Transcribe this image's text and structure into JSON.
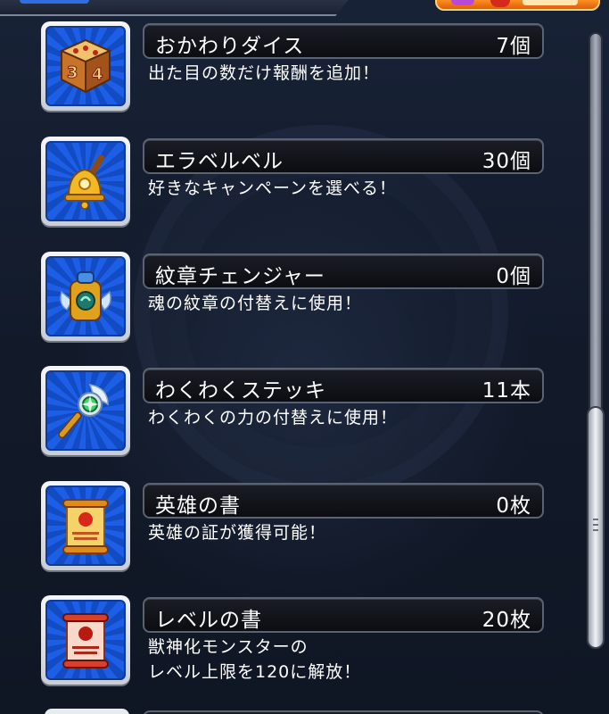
{
  "items": [
    {
      "name": "おかわりダイス",
      "count": "7個",
      "desc1": "出た目の数だけ報酬を追加！",
      "desc2": "",
      "icon": "dice-icon"
    },
    {
      "name": "エラベルベル",
      "count": "30個",
      "desc1": "好きなキャンペーンを選べる！",
      "desc2": "",
      "icon": "bell-icon"
    },
    {
      "name": "紋章チェンジャー",
      "count": "0個",
      "desc1": "魂の紋章の付替えに使用！",
      "desc2": "",
      "icon": "crest-changer-icon"
    },
    {
      "name": "わくわくステッキ",
      "count": "11本",
      "desc1": "わくわくの力の付替えに使用！",
      "desc2": "",
      "icon": "wand-icon"
    },
    {
      "name": "英雄の書",
      "count": "0枚",
      "desc1": "英雄の証が獲得可能！",
      "desc2": "",
      "icon": "scroll-gold-icon"
    },
    {
      "name": "レベルの書",
      "count": "20枚",
      "desc1": "獣神化モンスターの",
      "desc2": "レベル上限を120に解放！",
      "icon": "scroll-red-icon"
    }
  ],
  "colors": {
    "background": "#131b2c",
    "icon_tile": "#1c5fe6",
    "bar": "#0b0d12",
    "text": "#ffffff"
  }
}
